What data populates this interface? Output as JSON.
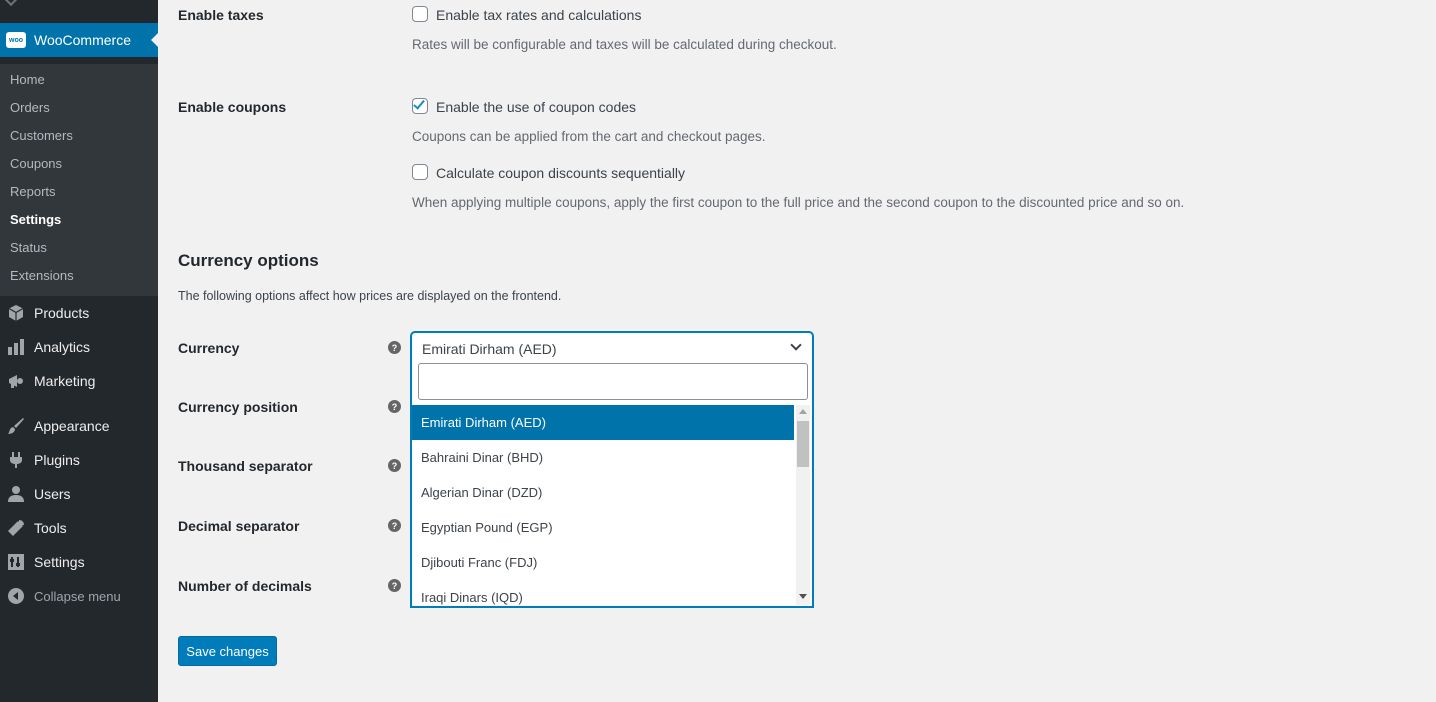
{
  "sidebar": {
    "woocommerce_label": "WooCommerce",
    "woo_logo_text": "woo",
    "submenu": [
      {
        "label": "Home"
      },
      {
        "label": "Orders"
      },
      {
        "label": "Customers"
      },
      {
        "label": "Coupons"
      },
      {
        "label": "Reports"
      },
      {
        "label": "Settings"
      },
      {
        "label": "Status"
      },
      {
        "label": "Extensions"
      }
    ],
    "menu": [
      {
        "label": "Products",
        "icon": "box-icon"
      },
      {
        "label": "Analytics",
        "icon": "bar-chart-icon"
      },
      {
        "label": "Marketing",
        "icon": "megaphone-icon"
      },
      {
        "label": "Appearance",
        "icon": "paintbrush-icon"
      },
      {
        "label": "Plugins",
        "icon": "plug-icon"
      },
      {
        "label": "Users",
        "icon": "user-icon"
      },
      {
        "label": "Tools",
        "icon": "wrench-icon"
      },
      {
        "label": "Settings",
        "icon": "settings-icon"
      }
    ],
    "collapse_label": "Collapse menu"
  },
  "taxes": {
    "label": "Enable taxes",
    "checkbox_label": "Enable tax rates and calculations",
    "checked": false,
    "description": "Rates will be configurable and taxes will be calculated during checkout."
  },
  "coupons": {
    "label": "Enable coupons",
    "checkbox_label": "Enable the use of coupon codes",
    "checked": true,
    "description": "Coupons can be applied from the cart and checkout pages.",
    "sequential_label": "Calculate coupon discounts sequentially",
    "sequential_checked": false,
    "sequential_description": "When applying multiple coupons, apply the first coupon to the full price and the second coupon to the discounted price and so on."
  },
  "currency_section": {
    "title": "Currency options",
    "description": "The following options affect how prices are displayed on the frontend.",
    "fields": [
      {
        "label": "Currency"
      },
      {
        "label": "Currency position"
      },
      {
        "label": "Thousand separator"
      },
      {
        "label": "Decimal separator"
      },
      {
        "label": "Number of decimals"
      }
    ],
    "help_glyph": "?",
    "selected_currency": "Emirati Dirham (AED)",
    "search_value": "",
    "options": [
      {
        "label": "Emirati Dirham (AED)",
        "highlighted": true
      },
      {
        "label": "Bahraini Dinar (BHD)"
      },
      {
        "label": "Algerian Dinar (DZD)"
      },
      {
        "label": "Egyptian Pound (EGP)"
      },
      {
        "label": "Djibouti Franc (FDJ)"
      },
      {
        "label": "Iraqi Dinars (IQD)"
      }
    ]
  },
  "save_label": "Save changes",
  "colors": {
    "sidebar_bg": "#23282d",
    "submenu_bg": "#32373c",
    "accent": "#0073aa",
    "button": "#007cba"
  }
}
